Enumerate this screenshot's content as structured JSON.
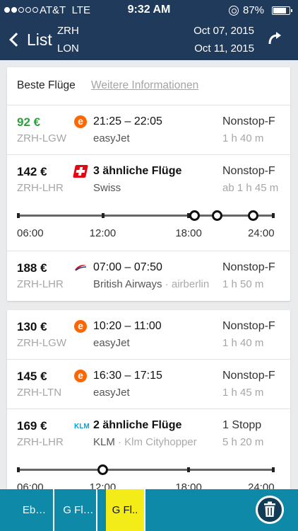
{
  "status_bar": {
    "carrier": "AT&T",
    "network": "LTE",
    "time": "9:32 AM",
    "battery": "87%",
    "battery_level": 0.87,
    "signal_bars": 2
  },
  "nav": {
    "back_label": "List",
    "from": "ZRH",
    "to": "LON",
    "date_out": "Oct 07, 2015",
    "date_return": "Oct 11, 2015"
  },
  "tabs": {
    "best": "Beste Flüge",
    "more": "Weitere Informationen"
  },
  "flights": [
    {
      "price": "92 €",
      "route": "ZRH-LGW",
      "logo": "easyjet-logo",
      "time": "21:25 – 22:05",
      "airline": "easyJet",
      "airline_extra": "",
      "stops": "Nonstop-F",
      "duration": "1 h 40 m"
    },
    {
      "price": "142 €",
      "route": "ZRH-LHR",
      "logo": "swiss-logo",
      "time": "3 ähnliche Flüge",
      "airline": "Swiss",
      "airline_extra": "",
      "stops": "Nonstop-F",
      "duration": "ab 1 h 45 m"
    },
    {
      "price": "188 €",
      "route": "ZRH-LHR",
      "logo": "british-airways-logo",
      "time": "07:00 – 07:50",
      "airline": "British Airways",
      "airline_extra": " · airberlin",
      "stops": "Nonstop-F",
      "duration": "1 h 50 m"
    },
    {
      "price": "130 €",
      "route": "ZRH-LGW",
      "logo": "easyjet-logo",
      "time": "10:20 – 11:00",
      "airline": "easyJet",
      "airline_extra": "",
      "stops": "Nonstop-F",
      "duration": "1 h 40 m"
    },
    {
      "price": "145 €",
      "route": "ZRH-LTN",
      "logo": "easyjet-logo",
      "time": "16:30 – 17:15",
      "airline": "easyJet",
      "airline_extra": "",
      "stops": "Nonstop-F",
      "duration": "1 h 45 m"
    },
    {
      "price": "169 €",
      "route": "ZRH-LHR",
      "logo": "klm-logo",
      "time": "2 ähnliche Flüge",
      "airline": "KLM",
      "airline_extra": " · Klm Cityhopper",
      "stops": "1 Stopp",
      "duration": "5 h 20 m"
    }
  ],
  "timeline_labels": [
    "06:00",
    "12:00",
    "18:00",
    "24:00"
  ],
  "timeline_1_marks": [
    "18:25",
    "20:00",
    "22:30"
  ],
  "timeline_2_marks": [
    "12:00"
  ],
  "bottom_tabs": [
    "Eb…",
    "G Fl…",
    "G Fl.."
  ],
  "colors": {
    "header": "#1f3a5a",
    "cheap_price": "#2aa33c",
    "tabbar": "#0e8aa8",
    "active_tab": "#f3ec18"
  }
}
